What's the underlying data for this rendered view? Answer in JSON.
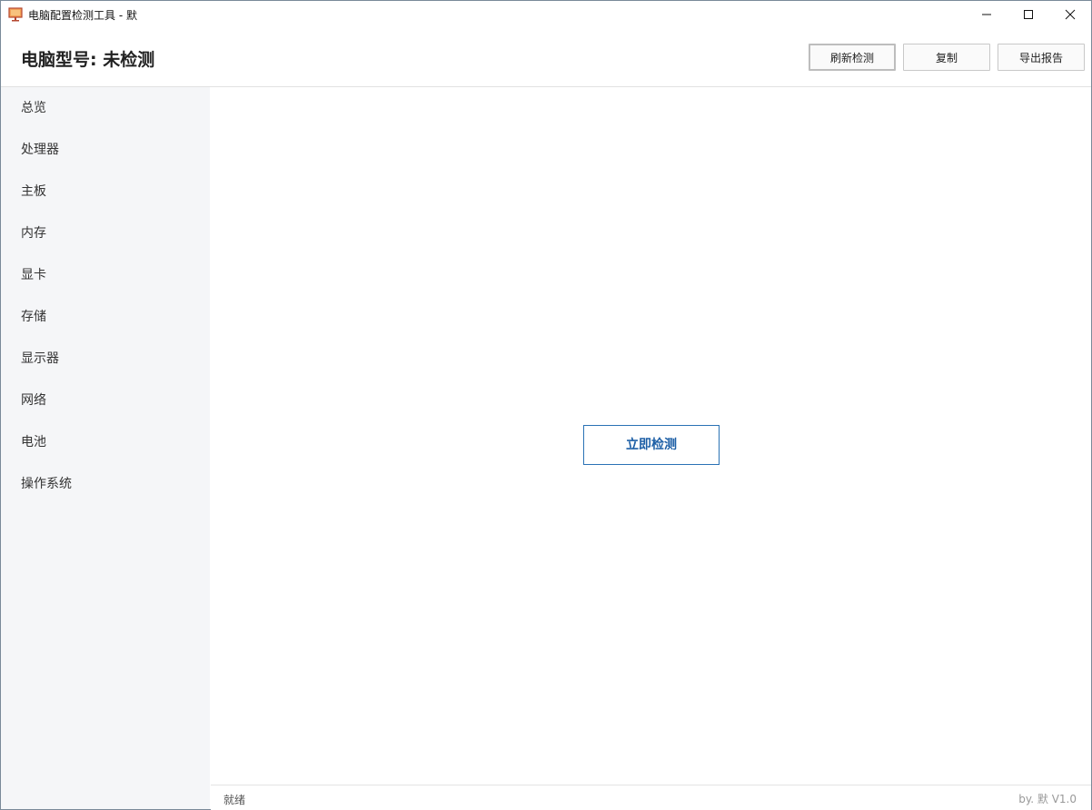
{
  "window": {
    "title": "电脑配置检测工具 - 默",
    "app_icon": "monitor-icon",
    "controls": {
      "minimize": "minimize-icon",
      "maximize": "maximize-icon",
      "close": "close-icon"
    }
  },
  "header": {
    "model_label": "电脑型号: 未检测",
    "buttons": {
      "refresh": "刷新检测",
      "copy": "复制",
      "export": "导出报告"
    }
  },
  "sidebar": {
    "items": [
      {
        "label": "总览"
      },
      {
        "label": "处理器"
      },
      {
        "label": "主板"
      },
      {
        "label": "内存"
      },
      {
        "label": "显卡"
      },
      {
        "label": "存储"
      },
      {
        "label": "显示器"
      },
      {
        "label": "网络"
      },
      {
        "label": "电池"
      },
      {
        "label": "操作系统"
      }
    ]
  },
  "main": {
    "detect_button": "立即检测"
  },
  "status": {
    "left": "就绪",
    "right": "by. 默 V1.0"
  },
  "colors": {
    "accent": "#1d5fa6",
    "sidebar_bg": "#f5f6f8",
    "border": "#e1e1e1"
  }
}
